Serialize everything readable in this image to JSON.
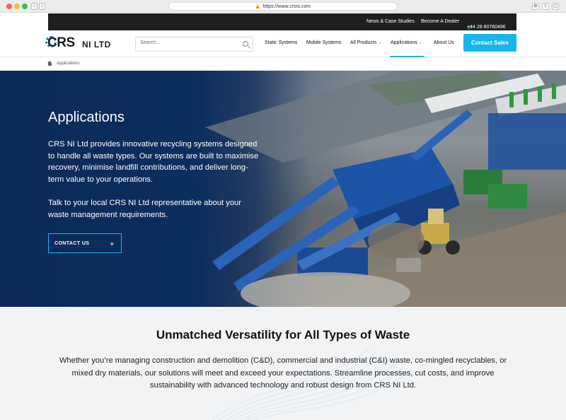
{
  "browser": {
    "url": "https://www.crsni.com"
  },
  "topbar": {
    "links": [
      "News & Case Studies",
      "Become A Dealer"
    ],
    "phone": "+44 28 80760496"
  },
  "logo": {
    "primary": "CRS",
    "secondary": "NI LTD"
  },
  "search": {
    "placeholder": "Search..."
  },
  "nav": {
    "items": [
      "Static Systems",
      "Mobile Systems",
      "All Products",
      "Applications",
      "About Us"
    ],
    "active": "Applications",
    "cta": "Contact Sales"
  },
  "breadcrumb": {
    "current": "Applications"
  },
  "hero": {
    "title": "Applications",
    "paragraph1": "CRS NI Ltd provides innovative recycling systems designed to handle all waste types. Our systems are built to maximise recovery, minimise landfill contributions, and deliver long-term value to your operations.",
    "paragraph2": "Talk to your local CRS NI Ltd representative about your waste management requirements.",
    "button": "CONTACT US",
    "button_arrow": "»"
  },
  "section": {
    "title": "Unmatched Versatility for All Types of Waste",
    "body": "Whether you’re managing construction and demolition (C&D), commercial and industrial (C&I) waste, co-mingled recyclables, or mixed dry materials, our solutions will meet and exceed your expectations. Streamline processes, cut costs, and improve sustainability with advanced technology and robust design from CRS NI Ltd."
  },
  "colors": {
    "accent": "#19b6f0",
    "hero_overlay": "#0b2a57",
    "topbar": "#1f1f1f"
  }
}
